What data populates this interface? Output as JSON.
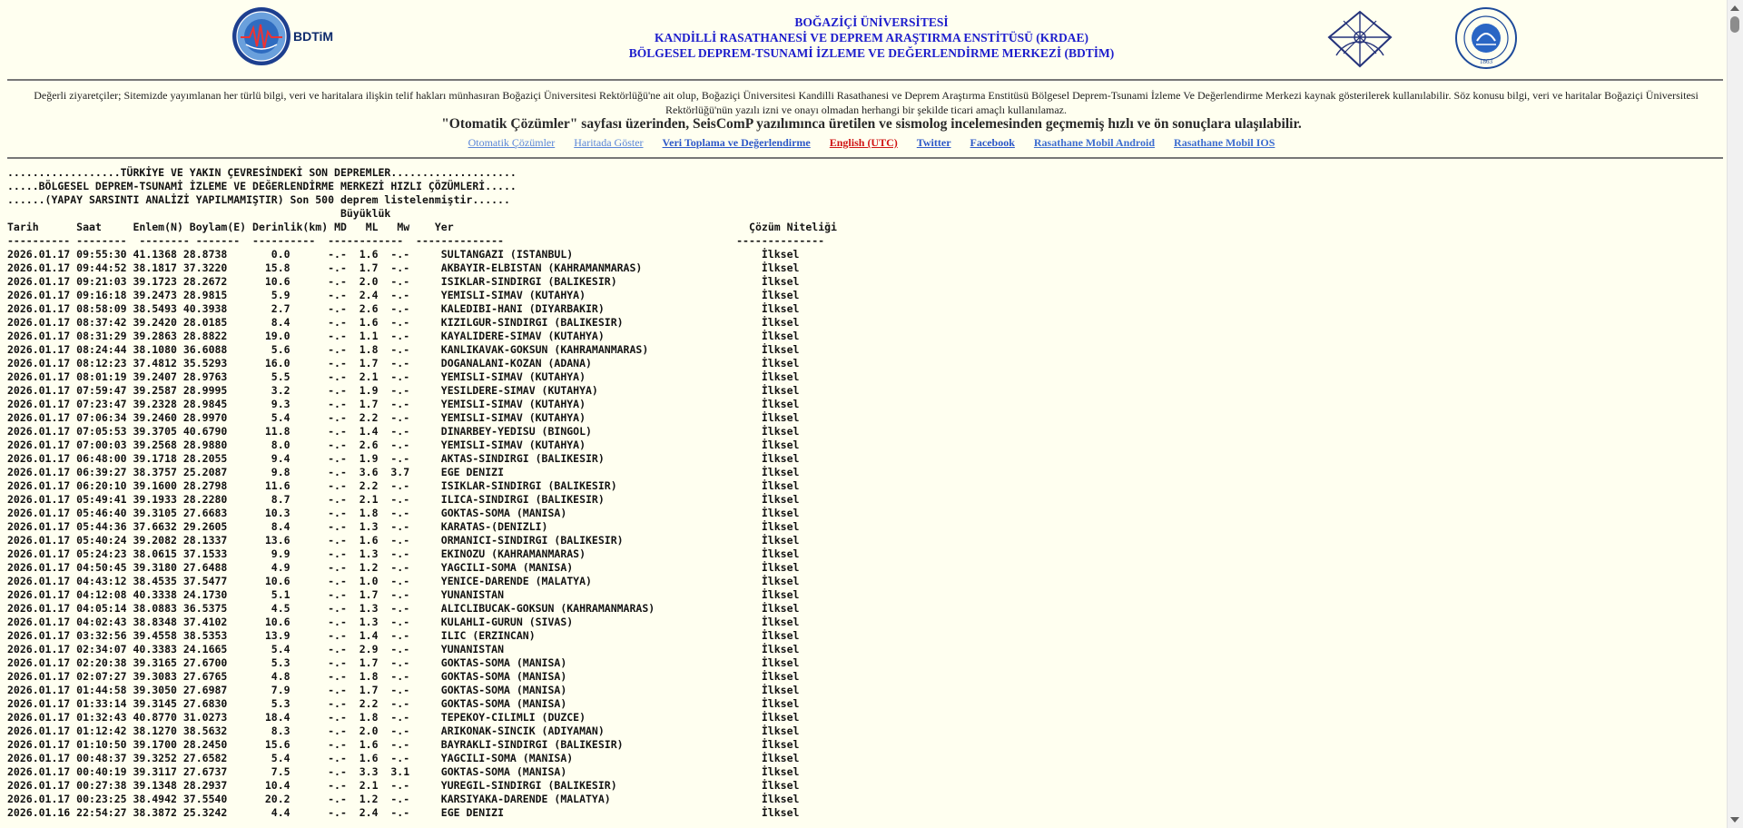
{
  "header": {
    "bdtim_logo_text": "BDTiM",
    "title_lines": [
      "BOĞAZİÇİ ÜNİVERSİTESİ",
      "KANDİLLİ RASATHANESİ VE DEPREM ARAŞTIRMA ENSTİTÜSÜ (KRDAE)",
      "BÖLGESEL DEPREM-TSUNAMİ İZLEME VE DEĞERLENDİRME MERKEZİ (BDTİM)"
    ],
    "bu_logo_year": "1863"
  },
  "notice": "Değerli ziyaretçiler; Sitemizde yayımlanan her türlü bilgi, veri ve haritalara ilişkin telif hakları münhasıran Boğaziçi Üniversitesi Rektörlüğü'ne ait olup, Boğaziçi Üniversitesi Kandilli Rasathanesi ve Deprem Araştırma Enstitüsü Bölgesel Deprem-Tsunami İzleme Ve Değerlendirme Merkezi kaynak gösterilerek kullanılabilir. Söz konusu bilgi, veri ve haritalar Boğaziçi Üniversitesi Rektörlüğü'nün yazılı izni ve onayı olmadan herhangi bir şekilde ticari amaçlı kullanılamaz.",
  "promo": "\"Otomatik Çözümler\" sayfası üzerinden, SeisComP yazılımınca üretilen ve sismolog incelemesinden geçmemiş hızlı ve ön sonuçlara ulaşılabilir.",
  "nav": [
    {
      "label": "Otomatik Çözümler",
      "style": "light"
    },
    {
      "label": "Haritada Göster",
      "style": "light"
    },
    {
      "label": "Veri Toplama ve Değerlendirme",
      "style": "normal"
    },
    {
      "label": "English (UTC)",
      "style": "red"
    },
    {
      "label": "Twitter",
      "style": "normal"
    },
    {
      "label": "Facebook",
      "style": "normal"
    },
    {
      "label": "Rasathane Mobil Android",
      "style": "mid"
    },
    {
      "label": "Rasathane Mobil IOS",
      "style": "mid"
    }
  ],
  "listing": {
    "banner_lines": [
      "..................TÜRKİYE VE YAKIN ÇEVRESİNDEKİ SON DEPREMLER....................",
      ".....BÖLGESEL DEPREM-TSUNAMİ İZLEME VE DEĞERLENDİRME MERKEZİ HIZLI ÇÖZÜMLERİ.....",
      "......(YAPAY SARSINTI ANALİZİ YAPILMAMIŞTIR) Son 500 deprem listelenmiştir......"
    ],
    "magnitude_label": "Büyüklük",
    "columns": [
      "Tarih",
      "Saat",
      "Enlem(N)",
      "Boylam(E)",
      "Derinlik(km)",
      "MD",
      "ML",
      "Mw",
      "Yer",
      "Çözüm Niteliği"
    ],
    "rows": [
      [
        "2026.01.17",
        "09:55:30",
        "41.1368",
        "28.8738",
        "0.0",
        "-.-",
        "1.6",
        "-.-",
        "SULTANGAZI (ISTANBUL)",
        "İlksel"
      ],
      [
        "2026.01.17",
        "09:44:52",
        "38.1817",
        "37.3220",
        "15.8",
        "-.-",
        "1.7",
        "-.-",
        "AKBAYIR-ELBISTAN (KAHRAMANMARAS)",
        "İlksel"
      ],
      [
        "2026.01.17",
        "09:21:03",
        "39.1723",
        "28.2672",
        "10.6",
        "-.-",
        "2.0",
        "-.-",
        "ISIKLAR-SINDIRGI (BALIKESIR)",
        "İlksel"
      ],
      [
        "2026.01.17",
        "09:16:18",
        "39.2473",
        "28.9815",
        "5.9",
        "-.-",
        "2.4",
        "-.-",
        "YEMISLI-SIMAV (KUTAHYA)",
        "İlksel"
      ],
      [
        "2026.01.17",
        "08:58:09",
        "38.5493",
        "40.3938",
        "2.7",
        "-.-",
        "2.6",
        "-.-",
        "KALEDIBI-HANI (DIYARBAKIR)",
        "İlksel"
      ],
      [
        "2026.01.17",
        "08:37:42",
        "39.2420",
        "28.0185",
        "8.4",
        "-.-",
        "1.6",
        "-.-",
        "KIZILGUR-SINDIRGI (BALIKESIR)",
        "İlksel"
      ],
      [
        "2026.01.17",
        "08:31:29",
        "39.2863",
        "28.8822",
        "19.0",
        "-.-",
        "1.1",
        "-.-",
        "KAYALIDERE-SIMAV (KUTAHYA)",
        "İlksel"
      ],
      [
        "2026.01.17",
        "08:24:44",
        "38.1080",
        "36.6088",
        "5.6",
        "-.-",
        "1.8",
        "-.-",
        "KANLIKAVAK-GOKSUN (KAHRAMANMARAS)",
        "İlksel"
      ],
      [
        "2026.01.17",
        "08:12:23",
        "37.4812",
        "35.5293",
        "16.0",
        "-.-",
        "1.7",
        "-.-",
        "DOGANALANI-KOZAN (ADANA)",
        "İlksel"
      ],
      [
        "2026.01.17",
        "08:01:19",
        "39.2407",
        "28.9763",
        "5.5",
        "-.-",
        "2.1",
        "-.-",
        "YEMISLI-SIMAV (KUTAHYA)",
        "İlksel"
      ],
      [
        "2026.01.17",
        "07:59:47",
        "39.2587",
        "28.9995",
        "3.2",
        "-.-",
        "1.9",
        "-.-",
        "YESILDERE-SIMAV (KUTAHYA)",
        "İlksel"
      ],
      [
        "2026.01.17",
        "07:23:47",
        "39.2328",
        "28.9845",
        "9.3",
        "-.-",
        "1.7",
        "-.-",
        "YEMISLI-SIMAV (KUTAHYA)",
        "İlksel"
      ],
      [
        "2026.01.17",
        "07:06:34",
        "39.2460",
        "28.9970",
        "5.4",
        "-.-",
        "2.2",
        "-.-",
        "YEMISLI-SIMAV (KUTAHYA)",
        "İlksel"
      ],
      [
        "2026.01.17",
        "07:05:53",
        "39.3705",
        "40.6790",
        "11.8",
        "-.-",
        "1.4",
        "-.-",
        "DINARBEY-YEDISU (BINGOL)",
        "İlksel"
      ],
      [
        "2026.01.17",
        "07:00:03",
        "39.2568",
        "28.9880",
        "8.0",
        "-.-",
        "2.6",
        "-.-",
        "YEMISLI-SIMAV (KUTAHYA)",
        "İlksel"
      ],
      [
        "2026.01.17",
        "06:48:00",
        "39.1718",
        "28.2055",
        "9.4",
        "-.-",
        "1.9",
        "-.-",
        "AKTAS-SINDIRGI (BALIKESIR)",
        "İlksel"
      ],
      [
        "2026.01.17",
        "06:39:27",
        "38.3757",
        "25.2087",
        "9.8",
        "-.-",
        "3.6",
        "3.7",
        "EGE DENIZI",
        "İlksel"
      ],
      [
        "2026.01.17",
        "06:20:10",
        "39.1600",
        "28.2798",
        "11.6",
        "-.-",
        "2.2",
        "-.-",
        "ISIKLAR-SINDIRGI (BALIKESIR)",
        "İlksel"
      ],
      [
        "2026.01.17",
        "05:49:41",
        "39.1933",
        "28.2280",
        "8.7",
        "-.-",
        "2.1",
        "-.-",
        "ILICA-SINDIRGI (BALIKESIR)",
        "İlksel"
      ],
      [
        "2026.01.17",
        "05:46:40",
        "39.3105",
        "27.6683",
        "10.3",
        "-.-",
        "1.8",
        "-.-",
        "GOKTAS-SOMA (MANISA)",
        "İlksel"
      ],
      [
        "2026.01.17",
        "05:44:36",
        "37.6632",
        "29.2605",
        "8.4",
        "-.-",
        "1.3",
        "-.-",
        "KARATAS-(DENIZLI)",
        "İlksel"
      ],
      [
        "2026.01.17",
        "05:40:24",
        "39.2082",
        "28.1337",
        "13.6",
        "-.-",
        "1.6",
        "-.-",
        "ORMANICI-SINDIRGI (BALIKESIR)",
        "İlksel"
      ],
      [
        "2026.01.17",
        "05:24:23",
        "38.0615",
        "37.1533",
        "9.9",
        "-.-",
        "1.3",
        "-.-",
        "EKINOZU (KAHRAMANMARAS)",
        "İlksel"
      ],
      [
        "2026.01.17",
        "04:50:45",
        "39.3180",
        "27.6488",
        "4.9",
        "-.-",
        "1.2",
        "-.-",
        "YAGCILI-SOMA (MANISA)",
        "İlksel"
      ],
      [
        "2026.01.17",
        "04:43:12",
        "38.4535",
        "37.5477",
        "10.6",
        "-.-",
        "1.0",
        "-.-",
        "YENICE-DARENDE (MALATYA)",
        "İlksel"
      ],
      [
        "2026.01.17",
        "04:12:08",
        "40.3338",
        "24.1730",
        "5.1",
        "-.-",
        "1.7",
        "-.-",
        "YUNANISTAN",
        "İlksel"
      ],
      [
        "2026.01.17",
        "04:05:14",
        "38.0883",
        "36.5375",
        "4.5",
        "-.-",
        "1.3",
        "-.-",
        "ALICLIBUCAK-GOKSUN (KAHRAMANMARAS)",
        "İlksel"
      ],
      [
        "2026.01.17",
        "04:02:43",
        "38.8348",
        "37.4102",
        "10.6",
        "-.-",
        "1.3",
        "-.-",
        "KULAHLI-GURUN (SIVAS)",
        "İlksel"
      ],
      [
        "2026.01.17",
        "03:32:56",
        "39.4558",
        "38.5353",
        "13.9",
        "-.-",
        "1.4",
        "-.-",
        "ILIC (ERZINCAN)",
        "İlksel"
      ],
      [
        "2026.01.17",
        "02:34:07",
        "40.3383",
        "24.1665",
        "5.4",
        "-.-",
        "2.9",
        "-.-",
        "YUNANISTAN",
        "İlksel"
      ],
      [
        "2026.01.17",
        "02:20:38",
        "39.3165",
        "27.6700",
        "5.3",
        "-.-",
        "1.7",
        "-.-",
        "GOKTAS-SOMA (MANISA)",
        "İlksel"
      ],
      [
        "2026.01.17",
        "02:07:27",
        "39.3083",
        "27.6765",
        "4.8",
        "-.-",
        "1.8",
        "-.-",
        "GOKTAS-SOMA (MANISA)",
        "İlksel"
      ],
      [
        "2026.01.17",
        "01:44:58",
        "39.3050",
        "27.6987",
        "7.9",
        "-.-",
        "1.7",
        "-.-",
        "GOKTAS-SOMA (MANISA)",
        "İlksel"
      ],
      [
        "2026.01.17",
        "01:33:14",
        "39.3145",
        "27.6830",
        "5.3",
        "-.-",
        "2.2",
        "-.-",
        "GOKTAS-SOMA (MANISA)",
        "İlksel"
      ],
      [
        "2026.01.17",
        "01:32:43",
        "40.8770",
        "31.0273",
        "18.4",
        "-.-",
        "1.8",
        "-.-",
        "TEPEKOY-CILIMLI (DUZCE)",
        "İlksel"
      ],
      [
        "2026.01.17",
        "01:12:42",
        "38.1270",
        "38.5632",
        "8.3",
        "-.-",
        "2.0",
        "-.-",
        "ARIKONAK-SINCIK (ADIYAMAN)",
        "İlksel"
      ],
      [
        "2026.01.17",
        "01:10:50",
        "39.1700",
        "28.2450",
        "15.6",
        "-.-",
        "1.6",
        "-.-",
        "BAYRAKLI-SINDIRGI (BALIKESIR)",
        "İlksel"
      ],
      [
        "2026.01.17",
        "00:48:37",
        "39.3252",
        "27.6582",
        "5.4",
        "-.-",
        "1.6",
        "-.-",
        "YAGCILI-SOMA (MANISA)",
        "İlksel"
      ],
      [
        "2026.01.17",
        "00:40:19",
        "39.3117",
        "27.6737",
        "7.5",
        "-.-",
        "3.3",
        "3.1",
        "GOKTAS-SOMA (MANISA)",
        "İlksel"
      ],
      [
        "2026.01.17",
        "00:27:38",
        "39.1348",
        "28.2937",
        "10.4",
        "-.-",
        "2.1",
        "-.-",
        "YUREGIL-SINDIRGI (BALIKESIR)",
        "İlksel"
      ],
      [
        "2026.01.17",
        "00:23:25",
        "38.4942",
        "37.5540",
        "20.2",
        "-.-",
        "1.2",
        "-.-",
        "KARSIYAKA-DARENDE (MALATYA)",
        "İlksel"
      ],
      [
        "2026.01.16",
        "22:54:27",
        "38.3872",
        "25.3242",
        "4.4",
        "-.-",
        "2.4",
        "-.-",
        "EGE DENIZI",
        "İlksel"
      ]
    ]
  }
}
